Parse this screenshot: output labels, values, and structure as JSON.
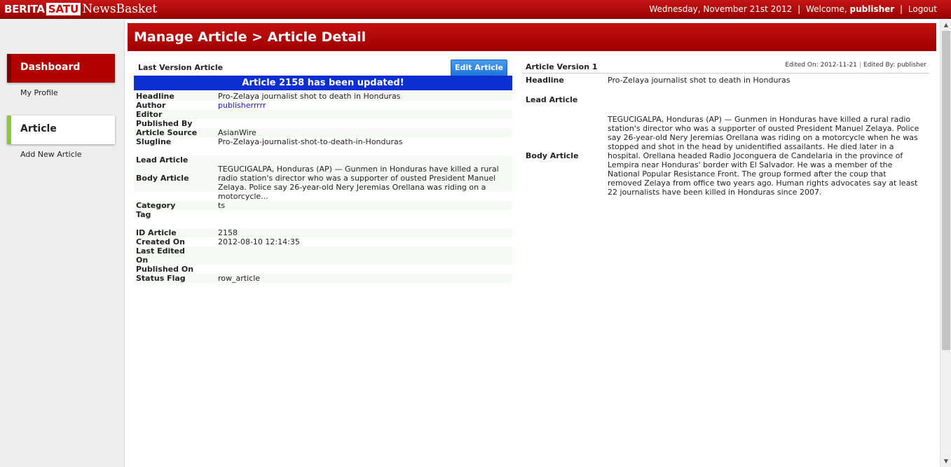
{
  "topbar": {
    "logo_berita": "BERITA",
    "logo_satu": "SATU",
    "logo_newsbasket": "NewsBasket",
    "date": "Wednesday, November 21st 2012",
    "welcome_prefix": "Welcome,",
    "username": "publisher",
    "logout": "Logout",
    "separator": "|"
  },
  "sidebar": {
    "dashboard_label": "Dashboard",
    "my_profile": "My Profile",
    "article_label": "Article",
    "add_new_article": "Add New Article"
  },
  "header": {
    "title": "Manage Article > Article Detail"
  },
  "left_panel": {
    "title": "Last Version Article",
    "edit_button": "Edit Article",
    "banner": "Article 2158 has been updated!",
    "fields": {
      "headline_label": "Headline",
      "headline_value": "Pro-Zelaya journalist shot to death in Honduras",
      "author_label": "Author",
      "author_value": "publisherrrrr",
      "editor_label": "Editor",
      "published_by_label": "Published By",
      "article_source_label": "Article Source",
      "article_source_value": "AsianWire",
      "slugline_label": "Slugline",
      "slugline_value": "Pro-Zelaya-journalist-shot-to-death-in-Honduras",
      "lead_article_label": "Lead Article",
      "body_article_label": "Body Article",
      "body_article_value": "TEGUCIGALPA, Honduras (AP) — Gunmen in Honduras have killed a rural radio station's director who was a supporter of ousted President Manuel Zelaya. Police say 26-year-old Nery Jeremias Orellana was riding on a motorcycle...",
      "category_label": "Category",
      "category_value": "ts",
      "tag_label": "Tag",
      "id_article_label": "ID Article",
      "id_article_value": "2158",
      "created_on_label": "Created On",
      "created_on_value": "2012-08-10 12:14:35",
      "last_edited_label_1": "Last Edited",
      "last_edited_label_2": "On",
      "published_on_label": "Published On",
      "status_flag_label": "Status Flag",
      "status_flag_value": "row_article"
    }
  },
  "right_panel": {
    "title": "Article Version 1",
    "edited_on": "Edited On: 2012-11-21",
    "edited_by": "Edited By: publisher",
    "pipe": "|",
    "headline_label": "Headline",
    "headline_value": "Pro-Zelaya journalist shot to death in Honduras",
    "lead_article_label": "Lead Article",
    "body_article_label": "Body Article",
    "body_article_value": "TEGUCIGALPA, Honduras (AP) — Gunmen in Honduras have killed a rural radio station's director who was a supporter of ousted President Manuel Zelaya. Police say 26-year-old Nery Jeremias Orellana was riding on a motorcycle when he was stopped and shot in the head by unidentified assailants. He died later in a hospital. Orellana headed Radio Joconguera de Candelaria in the province of Lempira near Honduras' border with El Salvador. He was a member of the National Popular Resistance Front. The group formed after the coup that removed Zelaya from office two years ago. Human rights advocates say at least 22 journalists have been killed in Honduras since 2007."
  },
  "icons": {
    "scroll_up": "▲",
    "scroll_down": "▼"
  }
}
